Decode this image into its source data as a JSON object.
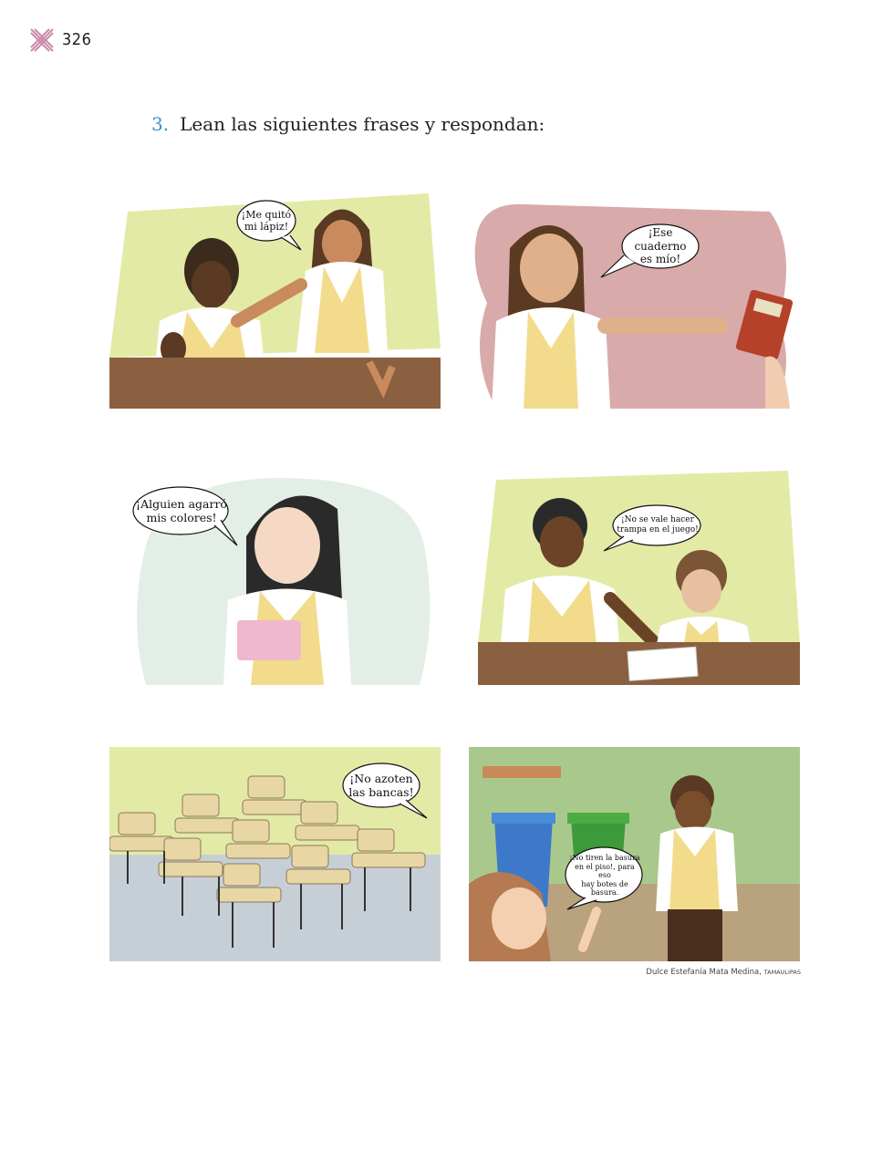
{
  "page": {
    "number": "326"
  },
  "exercise": {
    "number": "3.",
    "text": "Lean las siguientes frases y respondan:"
  },
  "panels": [
    {
      "speech": "¡Me quitó\nmi lápiz!"
    },
    {
      "speech": "¡Ese cuaderno\nes mío!"
    },
    {
      "speech": "¡Alguien agarró\nmis colores!"
    },
    {
      "speech": "¡No se vale hacer\ntrampa en el juego!"
    },
    {
      "speech": "¡No azoten\nlas bancas!"
    },
    {
      "speech": "¡No tiren la basura\nen el piso!, para eso\nhay botes de basura."
    }
  ],
  "credit": {
    "author": "Dulce Estefanía Mata Medina,",
    "state": "TAMAULIPAS"
  },
  "colors": {
    "accent": "#3a8fc4",
    "vest": "#f2dc8c",
    "desk": "#8a6040",
    "logo": "#c98aa8"
  }
}
